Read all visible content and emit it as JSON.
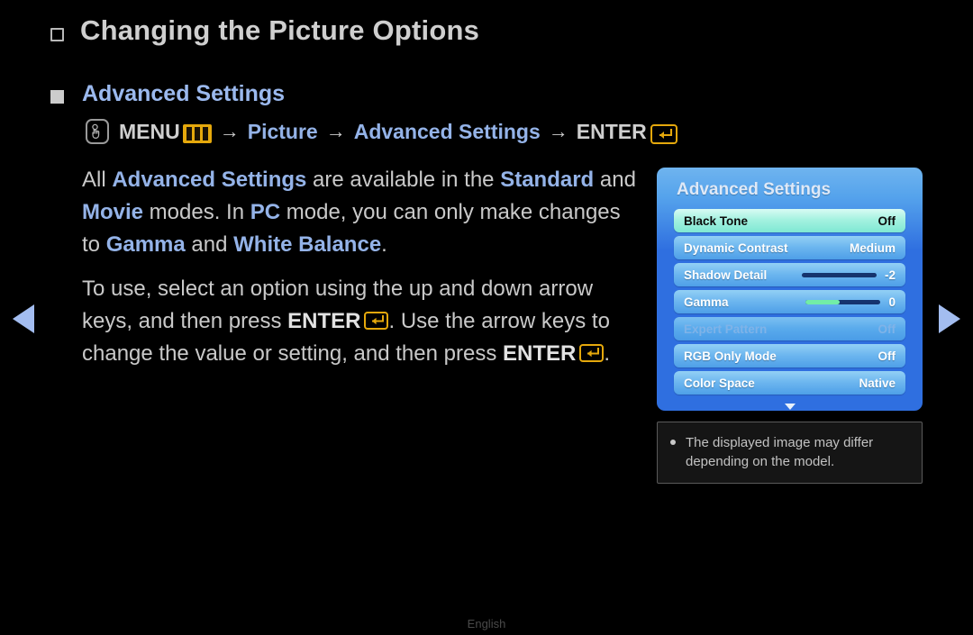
{
  "page": {
    "title": "Changing the Picture Options",
    "section_heading": "Advanced Settings",
    "footer_language": "English"
  },
  "menu_path": {
    "touch_icon": "hand-press-icon",
    "menu_label": "MENU",
    "menu_key_icon": "menu-key-icon",
    "arrow": "→",
    "picture_label": "Picture",
    "advanced_settings_label": "Advanced Settings",
    "enter_label": "ENTER",
    "enter_key_icon": "enter-key-icon"
  },
  "paragraphs": {
    "p1": {
      "t1": "All ",
      "b1": "Advanced Settings",
      "t2": " are available in the ",
      "b2": "Standard",
      "t3": " and ",
      "b3": "Movie",
      "t4": " modes. In ",
      "b4": "PC",
      "t5": " mode, you can only make changes to ",
      "b5": "Gamma",
      "t6": " and ",
      "b6": "White Balance",
      "t7": "."
    },
    "p2": {
      "t1": "To use, select an option using the up and down arrow keys, and then press ",
      "b1": "ENTER",
      "t2": ". Use the arrow keys to change the value or setting, and then press ",
      "b2": "ENTER",
      "t3": "."
    }
  },
  "nav": {
    "prev_icon": "left-triangle-icon",
    "next_icon": "right-triangle-icon"
  },
  "osd": {
    "title": "Advanced Settings",
    "scroll_down_icon": "chevron-down-icon",
    "rows": [
      {
        "label": "Black Tone",
        "value": "Off",
        "state": "selected",
        "slider": null
      },
      {
        "label": "Dynamic Contrast",
        "value": "Medium",
        "state": "normal",
        "slider": null
      },
      {
        "label": "Shadow Detail",
        "value": "-2",
        "state": "normal",
        "slider": 0
      },
      {
        "label": "Gamma",
        "value": "0",
        "state": "normal",
        "slider": 45
      },
      {
        "label": "Expert Pattern",
        "value": "Off",
        "state": "disabled",
        "slider": null
      },
      {
        "label": "RGB Only Mode",
        "value": "Off",
        "state": "normal",
        "slider": null
      },
      {
        "label": "Color Space",
        "value": "Native",
        "state": "normal",
        "slider": null
      }
    ]
  },
  "note": {
    "bullet_icon": "bullet-dot-icon",
    "text": "The displayed image may differ depending on the model."
  },
  "colors": {
    "background": "#000000",
    "accent_blue": "#94b3e8",
    "gold": "#e5a80c",
    "osd_blue": "#2f6fe0",
    "osd_highlight": "#a5f2e0",
    "slider_green": "#72eda7",
    "slider_track": "#16346e"
  }
}
